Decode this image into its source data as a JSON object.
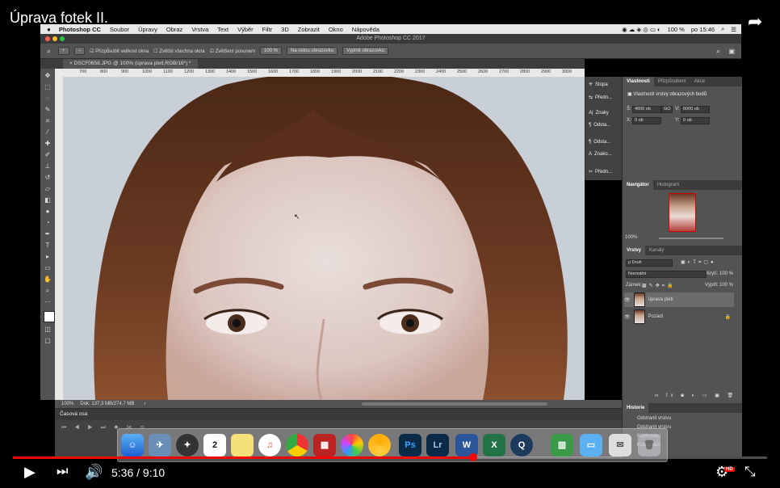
{
  "video": {
    "title": "Úprava fotek II.",
    "time_current": "5:36",
    "time_separator": "/",
    "time_total": "9:10",
    "progress_fraction": 0.61,
    "hd_badge": "HD"
  },
  "menubar": {
    "items": [
      "Photoshop CC",
      "Soubor",
      "Úpravy",
      "Obraz",
      "Vrstva",
      "Text",
      "Výběr",
      "Filtr",
      "3D",
      "Zobrazit",
      "Okno",
      "Nápověda"
    ],
    "battery": "100 %",
    "clock": "po 15:46"
  },
  "window": {
    "title": "Adobe Photoshop CC 2017"
  },
  "options": {
    "fit_window": "Přizpůsobit velikost okna",
    "zoom_all": "Zvětšit všechna okna",
    "scrubby_zoom": "Zvětšení posunem",
    "zoom_value": "100 %",
    "fit_screen": "Na celou obrazovku",
    "fill_screen": "Vyplnit obrazovku"
  },
  "document": {
    "tab_label": "DSCF0658.JPG @ 100% (úprava pleti,RGB/16*) *",
    "ruler_ticks": [
      "700",
      "800",
      "900",
      "1000",
      "1100",
      "1200",
      "1300",
      "1400",
      "1500",
      "1600",
      "1700",
      "1800",
      "1900",
      "2000",
      "2100",
      "2200",
      "2300",
      "2400",
      "2500",
      "2600",
      "2700",
      "2800",
      "2900",
      "3000"
    ]
  },
  "statusbar": {
    "zoom": "100%",
    "doc": "Dok: 137,3 MB/274,7 MB"
  },
  "timeline": {
    "title": "Časová osa"
  },
  "strip": [
    {
      "icon": "brush-preset-icon",
      "label": "Stopa"
    },
    {
      "icon": "preset-icon",
      "label": "Předn..."
    },
    {
      "icon": "character-icon",
      "label": "Znaky"
    },
    {
      "icon": "paragraph-icon",
      "label": "Odsta..."
    },
    {
      "icon": "paragraph-style-icon",
      "label": "Odsta..."
    },
    {
      "icon": "character-style-icon",
      "label": "Znako..."
    },
    {
      "icon": "tool-presets-icon",
      "label": "Předn..."
    }
  ],
  "properties": {
    "tabs": [
      "Vlastnosti",
      "Přizpůsobení",
      "Akce"
    ],
    "header": "Vlastnosti vrstvy obrazových bodů",
    "w_label": "Š:",
    "w_value": "4000 ob",
    "link": "GO",
    "h_label": "V:",
    "h_value": "6000 ob",
    "x_label": "X:",
    "x_value": "0 ob",
    "y_label": "Y:",
    "y_value": "0 ob"
  },
  "navigator": {
    "tabs": [
      "Navigátor",
      "Histogram"
    ],
    "zoom": "100%"
  },
  "layers": {
    "tabs": [
      "Vrstvy",
      "Kanály"
    ],
    "filter": "ρ Druh",
    "blend": "Normální",
    "opacity_label": "Krytí:",
    "opacity_value": "100 %",
    "lock_label": "Zámek:",
    "fill_label": "Výplň:",
    "fill_value": "100 %",
    "items": [
      {
        "name": "úprava pleti",
        "selected": true
      },
      {
        "name": "Pozadí",
        "selected": false
      }
    ]
  },
  "history": {
    "title": "Historie",
    "items": [
      "Odstranit vrstvu",
      "Odstranit vrstvu",
      "Kopírování",
      "Kopírování"
    ]
  },
  "dock": [
    "finder",
    "preview",
    "safari-compass",
    "calendar",
    "notes",
    "itunes",
    "chrome",
    "photobooth",
    "photos",
    "chrome-canary",
    "Ps",
    "Lr",
    "W",
    "X",
    "quicktime",
    "numbers",
    "folder",
    "mail",
    "trash"
  ],
  "calendar_day": "2",
  "colors": {
    "accent": "#ff0000",
    "ps_dark": "#535353"
  }
}
